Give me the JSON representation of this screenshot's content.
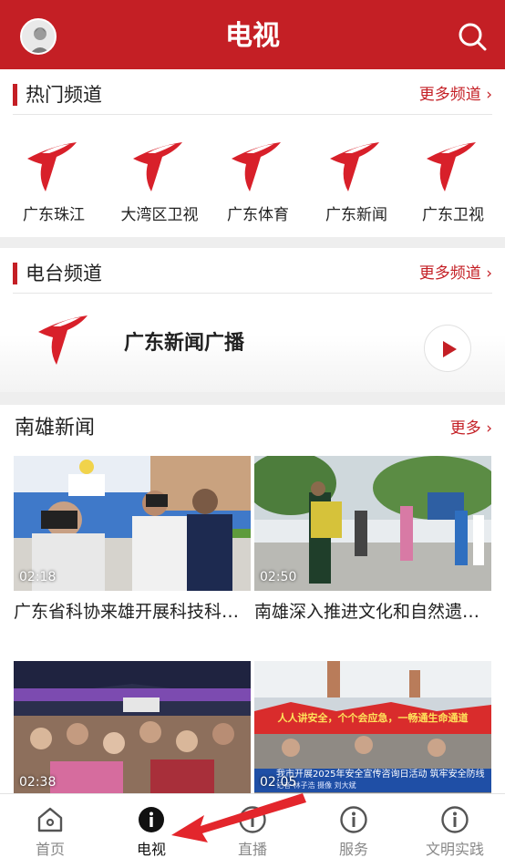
{
  "header": {
    "title": "电视"
  },
  "hot": {
    "title": "热门频道",
    "more": "更多频道 ›",
    "channels": [
      {
        "name": "广东珠江"
      },
      {
        "name": "大湾区卫视"
      },
      {
        "name": "广东体育"
      },
      {
        "name": "广东新闻"
      },
      {
        "name": "广东卫视"
      }
    ]
  },
  "radio": {
    "title": "电台频道",
    "more": "更多频道 ›",
    "station": "广东新闻广播"
  },
  "news": {
    "title": "南雄新闻",
    "more": "更多 ›",
    "items": [
      {
        "duration": "02:18",
        "caption": "广东省科协来雄开展科技科…"
      },
      {
        "duration": "02:50",
        "caption": "南雄深入推进文化和自然遗…"
      },
      {
        "duration": "02:38",
        "caption": ""
      },
      {
        "duration": "02:05",
        "caption": ""
      }
    ],
    "overlay": {
      "banner": "人人讲安全，个个会应急，一畅通生命通道",
      "ticker": "我市开展2025年安全宣传咨询日活动  筑牢安全防线",
      "ticker_sub": "记者 林子浩  摄像 刘大斌"
    }
  },
  "tabs": [
    {
      "label": "首页",
      "icon": "home-icon"
    },
    {
      "label": "电视",
      "icon": "info-icon"
    },
    {
      "label": "直播",
      "icon": "info-icon"
    },
    {
      "label": "服务",
      "icon": "info-icon"
    },
    {
      "label": "文明实践",
      "icon": "info-icon"
    }
  ],
  "colors": {
    "brand": "#c41f25",
    "inactive": "#888888",
    "arrow": "#e3262c"
  }
}
